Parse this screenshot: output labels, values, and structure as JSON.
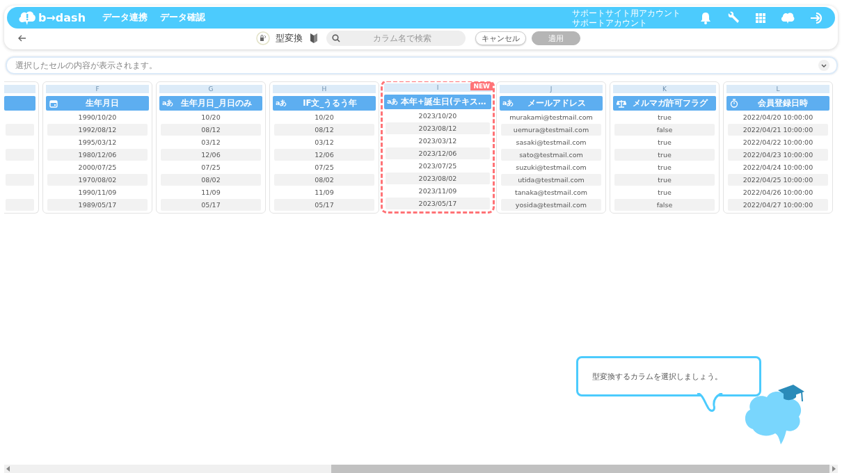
{
  "header": {
    "logo": "b→dash",
    "nav": [
      {
        "label": "データ連携"
      },
      {
        "label": "データ確認"
      }
    ],
    "account": [
      "サポートサイト用アカウント",
      "サポートアカウント"
    ]
  },
  "toolbar": {
    "title": "型変換",
    "search": {
      "placeholder": "カラム名で検索"
    },
    "buttons": [
      {
        "label": "キャンセル",
        "disabled": false
      },
      {
        "label": "適用",
        "disabled": true
      }
    ]
  },
  "cell_info": {
    "placeholder": "選択したセルの内容が表示されます。"
  },
  "columns": [
    {
      "letter": "F",
      "name": "生年月日",
      "kind": "date",
      "selected": false,
      "cells": [
        "1990/10/20",
        "1992/08/12",
        "1995/03/12",
        "1980/12/06",
        "2000/07/25",
        "1970/08/02",
        "1990/11/09",
        "1989/05/17"
      ]
    },
    {
      "letter": "G",
      "name": "生年月日_月日のみ",
      "kind": "text",
      "type_mark": "aあ",
      "selected": false,
      "cells": [
        "10/20",
        "08/12",
        "03/12",
        "12/06",
        "07/25",
        "08/02",
        "11/09",
        "05/17"
      ]
    },
    {
      "letter": "H",
      "name": "IF文_うるう年",
      "kind": "text",
      "type_mark": "aあ",
      "selected": false,
      "cells": [
        "10/20",
        "08/12",
        "03/12",
        "12/06",
        "07/25",
        "08/02",
        "11/09",
        "05/17"
      ]
    },
    {
      "letter": "I",
      "name": "本年+誕生日(テキス…",
      "kind": "text",
      "type_mark": "aあ",
      "selected": true,
      "badge": "NEW",
      "cells": [
        "2023/10/20",
        "2023/08/12",
        "2023/03/12",
        "2023/12/06",
        "2023/07/25",
        "2023/08/02",
        "2023/11/09",
        "2023/05/17"
      ]
    },
    {
      "letter": "J",
      "name": "メールアドレス",
      "kind": "text",
      "type_mark": "aあ",
      "selected": false,
      "cells": [
        "murakami@testmail.com",
        "uemura@testmail.com",
        "sasaki@testmail.com",
        "sato@testmail.com",
        "suzuki@testmail.com",
        "utida@testmail.com",
        "tanaka@testmail.com",
        "yosida@testmail.com"
      ]
    },
    {
      "letter": "K",
      "name": "メルマガ許可フラグ",
      "kind": "boolean",
      "selected": false,
      "cells": [
        "true",
        "false",
        "true",
        "true",
        "true",
        "true",
        "true",
        "false"
      ]
    },
    {
      "letter": "L",
      "name": "会員登録日時",
      "kind": "datetime",
      "selected": false,
      "cells": [
        "2022/04/20 10:00:00",
        "2022/04/21 10:00:00",
        "2022/04/22 10:00:00",
        "2022/04/23 10:00:00",
        "2022/04/24 10:00:00",
        "2022/04/25 10:00:00",
        "2022/04/26 10:00:00",
        "2022/04/27 10:00:00"
      ]
    }
  ],
  "tooltip": "型変換するカラムを選択しましょう。"
}
